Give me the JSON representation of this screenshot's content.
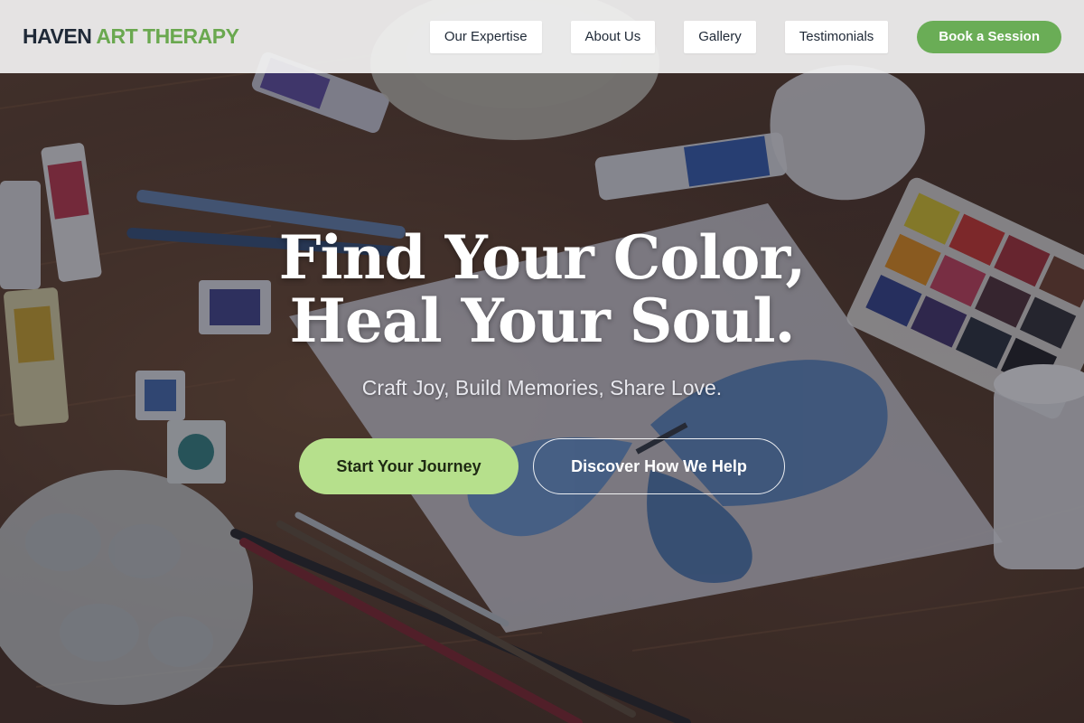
{
  "header": {
    "logo_primary": "HAVEN",
    "logo_accent": "ART THERAPY",
    "nav": [
      {
        "label": "Our Expertise"
      },
      {
        "label": "About Us"
      },
      {
        "label": "Gallery"
      },
      {
        "label": "Testimonials"
      }
    ],
    "book_label": "Book a Session"
  },
  "hero": {
    "title": "Find Your Color, Heal Your Soul.",
    "subtitle": "Craft Joy, Build Memories, Share Love.",
    "primary_cta": "Start Your Journey",
    "secondary_cta": "Discover How We Help",
    "background": "hero-art-supplies-image"
  },
  "colors": {
    "logo_dark": "#1f2937",
    "brand_green": "#6aad56",
    "cta_light_green": "#b6e08c",
    "header_bg": "#f3f3f3"
  }
}
